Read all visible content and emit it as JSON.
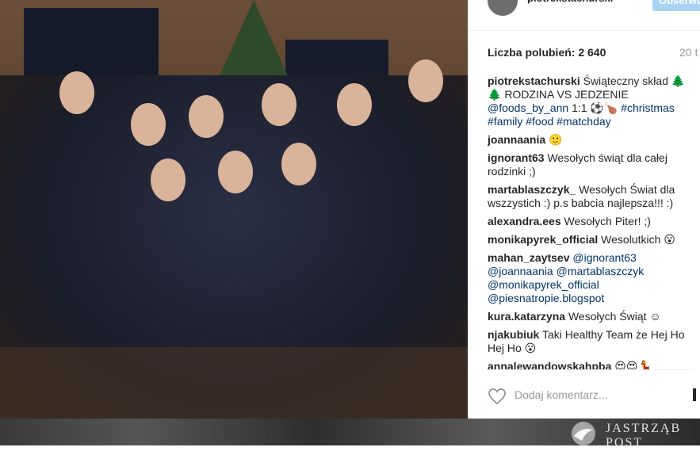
{
  "header": {
    "username": "piotrekstachurski",
    "follow_label": "Obserwuj"
  },
  "likes": "Liczba polubień: 2 640",
  "time": "20 t",
  "caption": {
    "user": "piotrekstachurski",
    "text": "Świąteczny skład 🌲🌲 RODZINA VS JEDZENIE",
    "mention": "@foods_by_ann",
    "score": "1:1 ⚽🍗 ",
    "tags": "#christmas #family #food #matchday"
  },
  "comments": [
    {
      "user": "joannaania",
      "text": "🙂"
    },
    {
      "user": "ignorant63",
      "text": "Wesołych świąt dla całej rodzinki ;)"
    },
    {
      "user": "martablaszczyk_",
      "text": "Wesołych Świat dla wszzystich :) p.s babcia najlepsza!!! :)"
    },
    {
      "user": "alexandra.ees",
      "text": "Wesołych Piter! ;)"
    },
    {
      "user": "monikapyrek_official",
      "text": "Wesolutkich 😮"
    },
    {
      "user": "mahan_zaytsev",
      "text": "@ignorant63 @joannaania @martablaszczyk @monikapyrek_official @piesnatropie.blogspot"
    },
    {
      "user": "kura.katarzyna",
      "text": "Wesołych Świąt ☺"
    },
    {
      "user": "njakubiuk",
      "text": "Taki Healthy Team że Hej Ho Hej Ho 😮"
    },
    {
      "user": "annalewandowskahpba",
      "text": "😍😍💃"
    }
  ],
  "add_comment_placeholder": "Dodaj komentarz...",
  "watermark": {
    "line1": "JASTRZĄB",
    "line2": "POST"
  },
  "icons": {
    "like": "heart-icon",
    "more": "more-options-icon",
    "avatar": "avatar"
  },
  "colors": {
    "link": "#003569",
    "follow_button": "#a8d4f3"
  }
}
